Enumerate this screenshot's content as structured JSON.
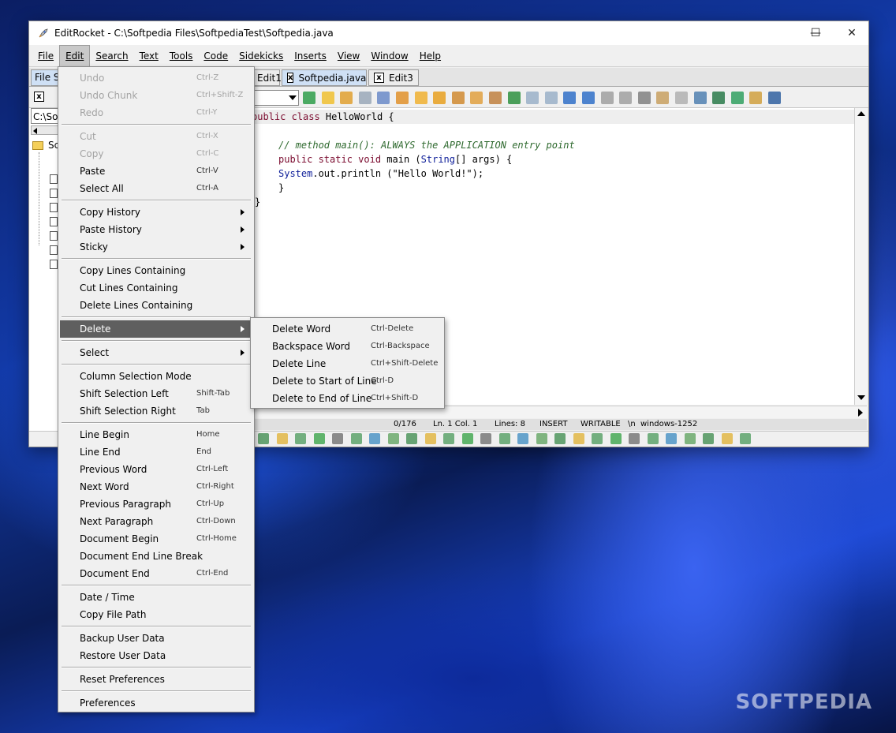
{
  "window": {
    "title": "EditRocket - C:\\Softpedia Files\\SoftpediaTest\\Softpedia.java",
    "minimize_glyph": "—",
    "maximize_glyph": "☐",
    "close_glyph": "✕"
  },
  "menubar": [
    "File",
    "Edit",
    "Search",
    "Text",
    "Tools",
    "Code",
    "Sidekicks",
    "Inserts",
    "View",
    "Window",
    "Help"
  ],
  "tabs": {
    "left_panel_tab": "File Sy",
    "editor_tabs": [
      "Edit1",
      "Softpedia.java",
      "Edit3"
    ],
    "close_glyph": "x"
  },
  "left_panel": {
    "path": "C:\\Sof",
    "root_label": "Sc"
  },
  "editor": {
    "lines": [
      {
        "kw": "public class ",
        "rest": "HelloWorld {"
      },
      {
        "text": ""
      },
      {
        "comment": "// method main(): ALWAYS the APPLICATION entry point"
      },
      {
        "kw": "public static void ",
        "rest1": "main (",
        "type": "String",
        "rest2": "[] args) {"
      },
      {
        "type": "System",
        "rest": ".out.println (\"Hello World!\");"
      },
      {
        "text": "}"
      },
      {
        "text": "}"
      }
    ]
  },
  "statusbar": {
    "pos": "0/176",
    "line_col": "Ln. 1 Col. 1",
    "lines": "Lines: 8",
    "mode": "INSERT",
    "access": "WRITABLE",
    "eol": "\\n",
    "encoding": "windows-1252"
  },
  "edit_menu": {
    "items": [
      {
        "label": "Undo",
        "shortcut": "Ctrl-Z",
        "disabled": true
      },
      {
        "label": "Undo Chunk",
        "shortcut": "Ctrl+Shift-Z",
        "disabled": true
      },
      {
        "label": "Redo",
        "shortcut": "Ctrl-Y",
        "disabled": true
      },
      {
        "label": "Cut",
        "shortcut": "Ctrl-X",
        "disabled": true
      },
      {
        "label": "Copy",
        "shortcut": "Ctrl-C",
        "disabled": true
      },
      {
        "label": "Paste",
        "shortcut": "Ctrl-V"
      },
      {
        "label": "Select All",
        "shortcut": "Ctrl-A"
      },
      {
        "label": "Copy History",
        "submenu": true
      },
      {
        "label": "Paste History",
        "submenu": true
      },
      {
        "label": "Sticky",
        "submenu": true
      },
      {
        "label": "Copy Lines Containing"
      },
      {
        "label": "Cut Lines Containing"
      },
      {
        "label": "Delete Lines Containing"
      },
      {
        "label": "Delete",
        "submenu": true,
        "highlighted": true
      },
      {
        "label": "Select",
        "submenu": true
      },
      {
        "label": "Column Selection Mode"
      },
      {
        "label": "Shift Selection Left",
        "shortcut": "Shift-Tab"
      },
      {
        "label": "Shift Selection Right",
        "shortcut": "Tab"
      },
      {
        "label": "Line Begin",
        "shortcut": "Home"
      },
      {
        "label": "Line End",
        "shortcut": "End"
      },
      {
        "label": "Previous Word",
        "shortcut": "Ctrl-Left"
      },
      {
        "label": "Next Word",
        "shortcut": "Ctrl-Right"
      },
      {
        "label": "Previous Paragraph",
        "shortcut": "Ctrl-Up"
      },
      {
        "label": "Next Paragraph",
        "shortcut": "Ctrl-Down"
      },
      {
        "label": "Document Begin",
        "shortcut": "Ctrl-Home"
      },
      {
        "label": "Document End Line Break"
      },
      {
        "label": "Document End",
        "shortcut": "Ctrl-End"
      },
      {
        "label": "Date / Time"
      },
      {
        "label": "Copy File Path"
      },
      {
        "label": "Backup User Data"
      },
      {
        "label": "Restore User Data"
      },
      {
        "label": "Reset Preferences"
      },
      {
        "label": "Preferences"
      }
    ]
  },
  "delete_submenu": {
    "items": [
      {
        "label": "Delete Word",
        "shortcut": "Ctrl-Delete"
      },
      {
        "label": "Backspace Word",
        "shortcut": "Ctrl-Backspace"
      },
      {
        "label": "Delete Line",
        "shortcut": "Ctrl+Shift-Delete"
      },
      {
        "label": "Delete to Start of Line",
        "shortcut": "Ctrl-D"
      },
      {
        "label": "Delete to End of Line",
        "shortcut": "Ctrl+Shift-D"
      }
    ]
  },
  "watermark": "SOFTPEDIA",
  "colors": {
    "keyword": "#7a0a2e",
    "comment": "#2f6a2f",
    "type": "#10209a",
    "menu_highlight": "#5f5f5f"
  }
}
